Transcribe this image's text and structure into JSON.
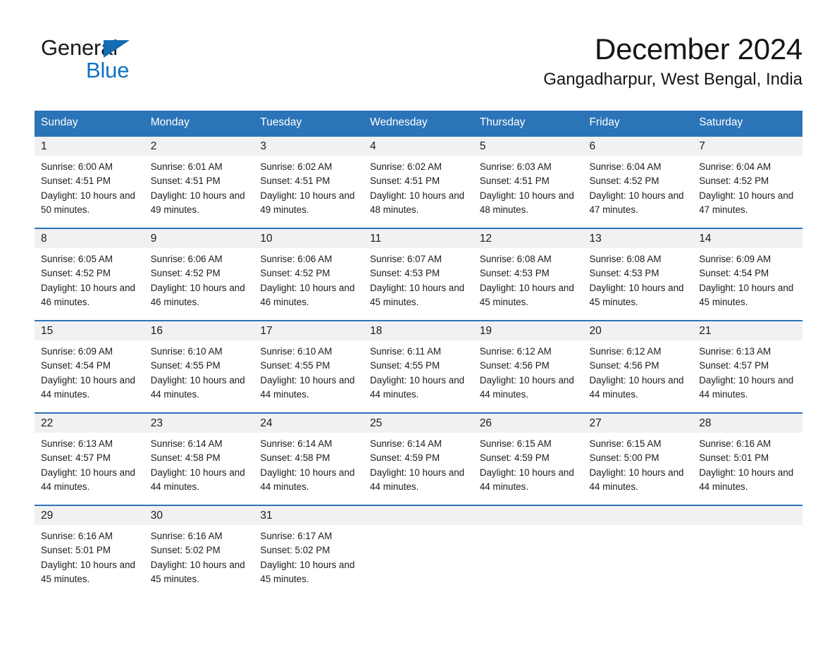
{
  "brand": {
    "name_part1": "General",
    "name_part2": "Blue",
    "triangle_color": "#126db3",
    "blue_text_color": "#0f72c4"
  },
  "header": {
    "month_title": "December 2024",
    "location": "Gangadharpur, West Bengal, India"
  },
  "theme": {
    "header_blue": "#2b74b8",
    "daynum_band": "#f1f1f1",
    "text": "#1b1b1b"
  },
  "calendar": {
    "weekday_headers": [
      "Sunday",
      "Monday",
      "Tuesday",
      "Wednesday",
      "Thursday",
      "Friday",
      "Saturday"
    ],
    "weeks": [
      [
        {
          "day": "1",
          "sunrise": "Sunrise: 6:00 AM",
          "sunset": "Sunset: 4:51 PM",
          "daylight": "Daylight: 10 hours and 50 minutes."
        },
        {
          "day": "2",
          "sunrise": "Sunrise: 6:01 AM",
          "sunset": "Sunset: 4:51 PM",
          "daylight": "Daylight: 10 hours and 49 minutes."
        },
        {
          "day": "3",
          "sunrise": "Sunrise: 6:02 AM",
          "sunset": "Sunset: 4:51 PM",
          "daylight": "Daylight: 10 hours and 49 minutes."
        },
        {
          "day": "4",
          "sunrise": "Sunrise: 6:02 AM",
          "sunset": "Sunset: 4:51 PM",
          "daylight": "Daylight: 10 hours and 48 minutes."
        },
        {
          "day": "5",
          "sunrise": "Sunrise: 6:03 AM",
          "sunset": "Sunset: 4:51 PM",
          "daylight": "Daylight: 10 hours and 48 minutes."
        },
        {
          "day": "6",
          "sunrise": "Sunrise: 6:04 AM",
          "sunset": "Sunset: 4:52 PM",
          "daylight": "Daylight: 10 hours and 47 minutes."
        },
        {
          "day": "7",
          "sunrise": "Sunrise: 6:04 AM",
          "sunset": "Sunset: 4:52 PM",
          "daylight": "Daylight: 10 hours and 47 minutes."
        }
      ],
      [
        {
          "day": "8",
          "sunrise": "Sunrise: 6:05 AM",
          "sunset": "Sunset: 4:52 PM",
          "daylight": "Daylight: 10 hours and 46 minutes."
        },
        {
          "day": "9",
          "sunrise": "Sunrise: 6:06 AM",
          "sunset": "Sunset: 4:52 PM",
          "daylight": "Daylight: 10 hours and 46 minutes."
        },
        {
          "day": "10",
          "sunrise": "Sunrise: 6:06 AM",
          "sunset": "Sunset: 4:52 PM",
          "daylight": "Daylight: 10 hours and 46 minutes."
        },
        {
          "day": "11",
          "sunrise": "Sunrise: 6:07 AM",
          "sunset": "Sunset: 4:53 PM",
          "daylight": "Daylight: 10 hours and 45 minutes."
        },
        {
          "day": "12",
          "sunrise": "Sunrise: 6:08 AM",
          "sunset": "Sunset: 4:53 PM",
          "daylight": "Daylight: 10 hours and 45 minutes."
        },
        {
          "day": "13",
          "sunrise": "Sunrise: 6:08 AM",
          "sunset": "Sunset: 4:53 PM",
          "daylight": "Daylight: 10 hours and 45 minutes."
        },
        {
          "day": "14",
          "sunrise": "Sunrise: 6:09 AM",
          "sunset": "Sunset: 4:54 PM",
          "daylight": "Daylight: 10 hours and 45 minutes."
        }
      ],
      [
        {
          "day": "15",
          "sunrise": "Sunrise: 6:09 AM",
          "sunset": "Sunset: 4:54 PM",
          "daylight": "Daylight: 10 hours and 44 minutes."
        },
        {
          "day": "16",
          "sunrise": "Sunrise: 6:10 AM",
          "sunset": "Sunset: 4:55 PM",
          "daylight": "Daylight: 10 hours and 44 minutes."
        },
        {
          "day": "17",
          "sunrise": "Sunrise: 6:10 AM",
          "sunset": "Sunset: 4:55 PM",
          "daylight": "Daylight: 10 hours and 44 minutes."
        },
        {
          "day": "18",
          "sunrise": "Sunrise: 6:11 AM",
          "sunset": "Sunset: 4:55 PM",
          "daylight": "Daylight: 10 hours and 44 minutes."
        },
        {
          "day": "19",
          "sunrise": "Sunrise: 6:12 AM",
          "sunset": "Sunset: 4:56 PM",
          "daylight": "Daylight: 10 hours and 44 minutes."
        },
        {
          "day": "20",
          "sunrise": "Sunrise: 6:12 AM",
          "sunset": "Sunset: 4:56 PM",
          "daylight": "Daylight: 10 hours and 44 minutes."
        },
        {
          "day": "21",
          "sunrise": "Sunrise: 6:13 AM",
          "sunset": "Sunset: 4:57 PM",
          "daylight": "Daylight: 10 hours and 44 minutes."
        }
      ],
      [
        {
          "day": "22",
          "sunrise": "Sunrise: 6:13 AM",
          "sunset": "Sunset: 4:57 PM",
          "daylight": "Daylight: 10 hours and 44 minutes."
        },
        {
          "day": "23",
          "sunrise": "Sunrise: 6:14 AM",
          "sunset": "Sunset: 4:58 PM",
          "daylight": "Daylight: 10 hours and 44 minutes."
        },
        {
          "day": "24",
          "sunrise": "Sunrise: 6:14 AM",
          "sunset": "Sunset: 4:58 PM",
          "daylight": "Daylight: 10 hours and 44 minutes."
        },
        {
          "day": "25",
          "sunrise": "Sunrise: 6:14 AM",
          "sunset": "Sunset: 4:59 PM",
          "daylight": "Daylight: 10 hours and 44 minutes."
        },
        {
          "day": "26",
          "sunrise": "Sunrise: 6:15 AM",
          "sunset": "Sunset: 4:59 PM",
          "daylight": "Daylight: 10 hours and 44 minutes."
        },
        {
          "day": "27",
          "sunrise": "Sunrise: 6:15 AM",
          "sunset": "Sunset: 5:00 PM",
          "daylight": "Daylight: 10 hours and 44 minutes."
        },
        {
          "day": "28",
          "sunrise": "Sunrise: 6:16 AM",
          "sunset": "Sunset: 5:01 PM",
          "daylight": "Daylight: 10 hours and 44 minutes."
        }
      ],
      [
        {
          "day": "29",
          "sunrise": "Sunrise: 6:16 AM",
          "sunset": "Sunset: 5:01 PM",
          "daylight": "Daylight: 10 hours and 45 minutes."
        },
        {
          "day": "30",
          "sunrise": "Sunrise: 6:16 AM",
          "sunset": "Sunset: 5:02 PM",
          "daylight": "Daylight: 10 hours and 45 minutes."
        },
        {
          "day": "31",
          "sunrise": "Sunrise: 6:17 AM",
          "sunset": "Sunset: 5:02 PM",
          "daylight": "Daylight: 10 hours and 45 minutes."
        },
        {
          "day": "",
          "sunrise": "",
          "sunset": "",
          "daylight": ""
        },
        {
          "day": "",
          "sunrise": "",
          "sunset": "",
          "daylight": ""
        },
        {
          "day": "",
          "sunrise": "",
          "sunset": "",
          "daylight": ""
        },
        {
          "day": "",
          "sunrise": "",
          "sunset": "",
          "daylight": ""
        }
      ]
    ]
  }
}
